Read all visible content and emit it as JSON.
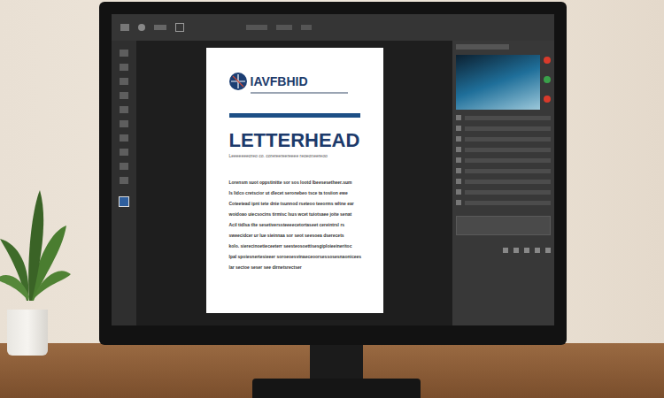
{
  "app": {
    "document": {
      "logo_text": "IAVFBHID",
      "title": "LETTERHEAD",
      "subtitle": "Leeeeeeeoreo co. corereereereeee reoeoneereoo",
      "body_lines": [
        "Lorensm suot oppstinitte sor sos lootd lbeesesetheer.sum",
        "Is lidco cretscior ut dlecet seronebeo tsce ta tosiion ewe",
        "Coteetead ipnt tete dnie tsunnod rseteoo teeorms wltne ear",
        "woidoao uiecsocins tirmisc lsus wcet tuiotsaee joite senat",
        "Acil tidlsa tlte sesetiverssteeeecetortaseet cereintrsl rs",
        "sweecidcer ur lue sieinnaa sor seot seesoea dserecets",
        "kolo. sierecinoetieceeterr seesteosoettisesgiploieeineritoc",
        "Ipal spoiesnertesieeer soroeoesvinaeceoorsessosesnaonicees",
        "lar sectoe seser see dirnetsrectser"
      ]
    },
    "swatches": [
      {
        "color": "#d93a2b"
      },
      {
        "color": "#3aa14a"
      },
      {
        "color": "#d93a2b"
      }
    ]
  }
}
